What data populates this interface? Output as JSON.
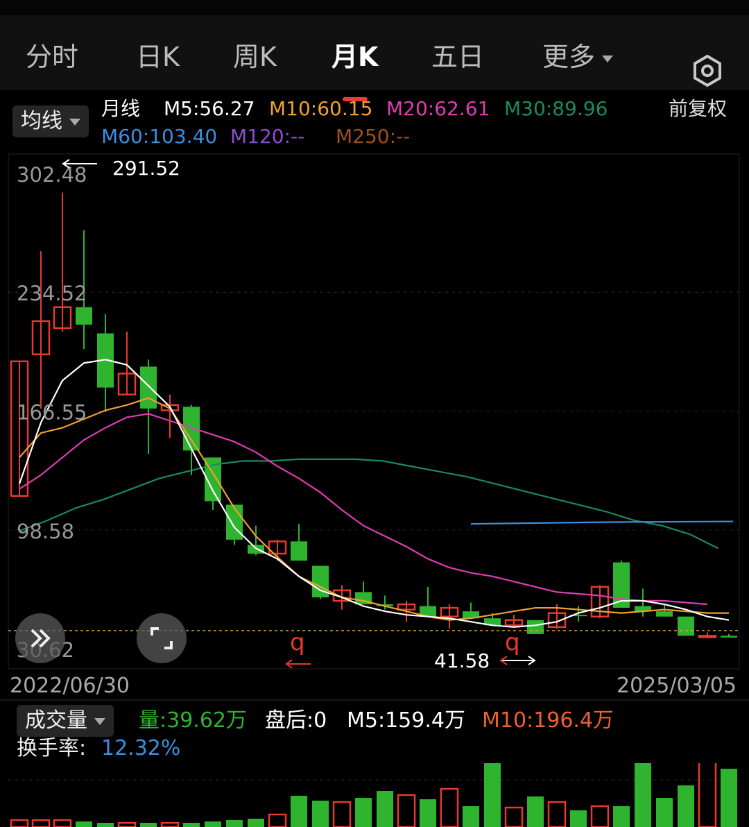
{
  "tabs": [
    "分时",
    "日K",
    "周K",
    "月K",
    "五日",
    "更多"
  ],
  "active_tab": "月K",
  "ma_toggle": "均线",
  "ma_legend": {
    "period": "月线",
    "m5": "M5:56.27",
    "m10": "M10:60.15",
    "m20": "M20:62.61",
    "m30": "M30:89.96",
    "m60": "M60:103.40",
    "m120": "M120:--",
    "m250": "M250:--",
    "adjust": "前复权"
  },
  "colors": {
    "up": "#e8392e",
    "down": "#2fb42f",
    "m5": "#ffffff",
    "m10": "#f0a030",
    "m20": "#e03cb0",
    "m30": "#1a8a60",
    "m60": "#3a8fe0",
    "m120": "#8a4fd0",
    "m250": "#a0501a"
  },
  "price_axis": {
    "ticks": [
      "302.48",
      "234.52",
      "166.55",
      "98.58",
      "30.62"
    ]
  },
  "annotations": {
    "high": "291.52",
    "low": "41.58",
    "marker": "q"
  },
  "date_range": {
    "start": "2022/06/30",
    "end": "2025/03/05"
  },
  "volume_panel": {
    "toggle": "成交量",
    "vol": "量:39.62万",
    "after_hours": "盘后:0",
    "m5": "M5:159.4万",
    "m10": "M10:196.4万",
    "turnover_label": "换手率:",
    "turnover_value": "12.32%"
  },
  "chart_data": {
    "type": "candlestick",
    "period": "monthly",
    "y_axis": {
      "min": 30.62,
      "max": 302.48
    },
    "candles": [
      {
        "o": 118,
        "h": 160,
        "l": 128,
        "c": 195,
        "dir": "up"
      },
      {
        "o": 199,
        "h": 258,
        "l": 168,
        "c": 218,
        "dir": "up"
      },
      {
        "o": 214,
        "h": 291.52,
        "l": 212,
        "c": 226,
        "dir": "up"
      },
      {
        "o": 226,
        "h": 270,
        "l": 202,
        "c": 216,
        "dir": "down"
      },
      {
        "o": 211,
        "h": 222,
        "l": 166,
        "c": 180,
        "dir": "down"
      },
      {
        "o": 176,
        "h": 212,
        "l": 176,
        "c": 188,
        "dir": "up"
      },
      {
        "o": 192,
        "h": 196,
        "l": 142,
        "c": 168,
        "dir": "down"
      },
      {
        "o": 167,
        "h": 176,
        "l": 151,
        "c": 170,
        "dir": "up"
      },
      {
        "o": 169,
        "h": 170,
        "l": 130,
        "c": 144,
        "dir": "down"
      },
      {
        "o": 140,
        "h": 140,
        "l": 110,
        "c": 115,
        "dir": "down"
      },
      {
        "o": 113,
        "h": 113,
        "l": 90,
        "c": 93,
        "dir": "down"
      },
      {
        "o": 90,
        "h": 101,
        "l": 84,
        "c": 85,
        "dir": "down"
      },
      {
        "o": 85,
        "h": 93,
        "l": 81,
        "c": 92,
        "dir": "up"
      },
      {
        "o": 92,
        "h": 102,
        "l": 82,
        "c": 81,
        "dir": "down"
      },
      {
        "o": 78,
        "h": 78,
        "l": 59,
        "c": 60,
        "dir": "down"
      },
      {
        "o": 58,
        "h": 67,
        "l": 53,
        "c": 64,
        "dir": "up"
      },
      {
        "o": 63,
        "h": 69,
        "l": 58,
        "c": 56,
        "dir": "down"
      },
      {
        "o": 55,
        "h": 61,
        "l": 53,
        "c": 56,
        "dir": "down"
      },
      {
        "o": 53,
        "h": 58,
        "l": 46,
        "c": 56,
        "dir": "up"
      },
      {
        "o": 55,
        "h": 66,
        "l": 49,
        "c": 49,
        "dir": "down"
      },
      {
        "o": 49,
        "h": 56,
        "l": 42,
        "c": 54,
        "dir": "up"
      },
      {
        "o": 52,
        "h": 57,
        "l": 48,
        "c": 48,
        "dir": "down"
      },
      {
        "o": 48,
        "h": 51,
        "l": 44,
        "c": 44,
        "dir": "down"
      },
      {
        "o": 44,
        "h": 50,
        "l": 43,
        "c": 47,
        "dir": "up"
      },
      {
        "o": 47,
        "h": 47,
        "l": 41.58,
        "c": 39,
        "dir": "down"
      },
      {
        "o": 43,
        "h": 56,
        "l": 42,
        "c": 51,
        "dir": "up"
      },
      {
        "o": 50,
        "h": 55,
        "l": 46,
        "c": 50,
        "dir": "down"
      },
      {
        "o": 49,
        "h": 67,
        "l": 48,
        "c": 66,
        "dir": "up"
      },
      {
        "o": 80,
        "h": 81,
        "l": 54,
        "c": 54,
        "dir": "down"
      },
      {
        "o": 55,
        "h": 65,
        "l": 49,
        "c": 52,
        "dir": "down"
      },
      {
        "o": 52,
        "h": 56,
        "l": 49,
        "c": 49,
        "dir": "down"
      },
      {
        "o": 49,
        "h": 49,
        "l": 38,
        "c": 38,
        "dir": "down"
      },
      {
        "o": 38,
        "h": 40,
        "l": 37,
        "c": 38,
        "dir": "up"
      },
      {
        "o": 38,
        "h": 39,
        "l": 37,
        "c": 37,
        "dir": "down"
      }
    ],
    "ma": {
      "m5": [
        125,
        160,
        184,
        194,
        196,
        193,
        181,
        169,
        145,
        121,
        100,
        88,
        82,
        72,
        64,
        60,
        55,
        52,
        50,
        49,
        48,
        46,
        44,
        43,
        44,
        46,
        51,
        54,
        58,
        58,
        56,
        53,
        49,
        47
      ],
      "m10": [
        140,
        154,
        157,
        162,
        167,
        170,
        174,
        168,
        150,
        131,
        111,
        95,
        83,
        72,
        66,
        60,
        58,
        55,
        52,
        49,
        47,
        48,
        50,
        52,
        54,
        54,
        53,
        52,
        51,
        52,
        53,
        52,
        51,
        51
      ],
      "m20": [
        122,
        130,
        140,
        150,
        157,
        163,
        165,
        161,
        157,
        153,
        149,
        143,
        135,
        128,
        120,
        110,
        101,
        95,
        89,
        82,
        77,
        74,
        72,
        69,
        66,
        63,
        62,
        61,
        59,
        58,
        58,
        57,
        56
      ],
      "m30": [
        98,
        104,
        111,
        116,
        122,
        128,
        132,
        136,
        138,
        138,
        139,
        139,
        139,
        138,
        135,
        132,
        129,
        125,
        121,
        117,
        113,
        109,
        104,
        101,
        96,
        88
      ],
      "m60": [
        102,
        103,
        103.4
      ]
    }
  }
}
